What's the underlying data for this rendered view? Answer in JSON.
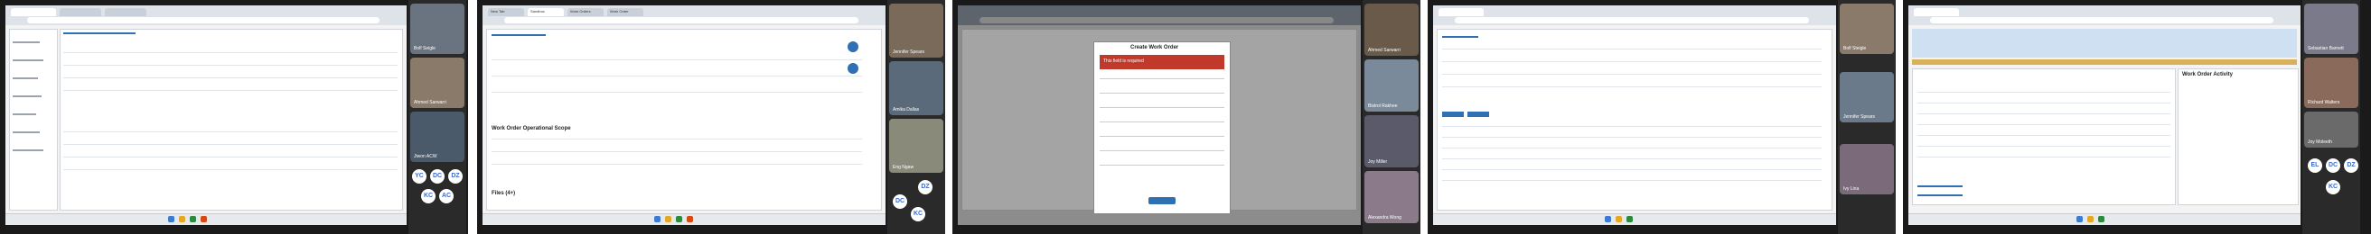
{
  "frames": [
    {
      "people": [
        {
          "name": "Bolf Seigle"
        },
        {
          "name": "Ahmed Sarwarri"
        },
        {
          "name": "Jiwon ACW"
        }
      ],
      "avatars": [
        "YC",
        "DC",
        "DZ",
        "KC",
        "AC"
      ]
    },
    {
      "window_title": "Work Order Operational Scope",
      "tabs": [
        "New Tab",
        "Sandbox",
        "Work Orders",
        "Work Order"
      ],
      "section_title": "Work Order Operational Scope",
      "footer_title": "Files (4+)",
      "people": [
        {
          "name": "Jennifer Spears"
        },
        {
          "name": "Amika Dallas"
        },
        {
          "name": "Eng Ngaw"
        }
      ],
      "avatars": [
        "DZ",
        "DC",
        "KC"
      ]
    },
    {
      "modal_title": "Create Work Order",
      "modal_error": "This field is required",
      "people": [
        {
          "name": "Ahmed Sarwarri"
        },
        {
          "name": "Bistrol Rakhee"
        },
        {
          "name": "Joy Miller"
        },
        {
          "name": "Alexandra Wong"
        }
      ]
    },
    {
      "people": [
        {
          "name": "Bolf Steigle"
        },
        {
          "name": "Jennifer Spears"
        },
        {
          "name": "Ivy Lina"
        }
      ]
    },
    {
      "panel_title": "Work Order Activity",
      "people": [
        {
          "name": "Sebastian Barnett"
        },
        {
          "name": "Richard Walters"
        },
        {
          "name": "Joy Moleeth"
        }
      ],
      "avatars": [
        "EL",
        "DC",
        "DZ",
        "KC"
      ]
    }
  ]
}
